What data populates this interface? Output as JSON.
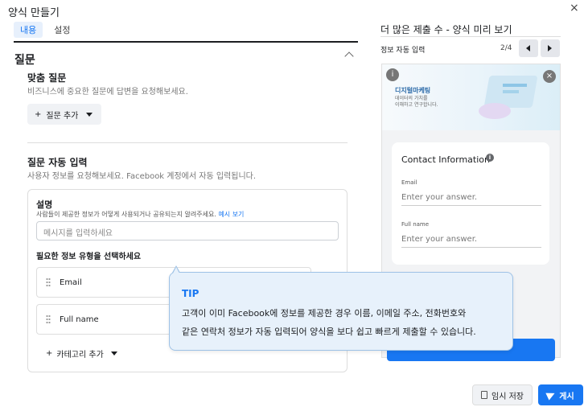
{
  "dialog": {
    "title": "양식 만들기",
    "close": "×"
  },
  "tabs": [
    {
      "label": "내용"
    },
    {
      "label": "설정"
    }
  ],
  "section": {
    "title": "질문"
  },
  "custom_questions": {
    "title": "맞춤 질문",
    "desc": "비즈니스에 중요한 질문에 답변을 요청해보세요.",
    "add_button": "질문 추가"
  },
  "autofill": {
    "title": "질문 자동 입력",
    "desc": "사용자 정보를 요청해보세요. Facebook 계정에서 자동 입력됩니다."
  },
  "description_card": {
    "label": "설명",
    "help": "사람들이 제공한 정보가 어떻게 사용되거나 공유되는지 알려주세요.",
    "help_link": "예시 보기",
    "placeholder": "메시지를 입력하세요",
    "required_label": "필요한 정보 유형을 선택하세요",
    "fields": [
      {
        "label": "Email"
      },
      {
        "label": "Full name"
      }
    ],
    "add_category": "카테고리 추가"
  },
  "preview": {
    "title": "더 많은 제출 수 - 양식 미리 보기",
    "subtitle": "정보 자동 입력",
    "page": "2/4",
    "banner": {
      "badge": "i",
      "close": "×",
      "headline": "디지털마케팅",
      "line1": "데이터의 가치를",
      "line2": "이해하고 연구합니다."
    },
    "form": {
      "heading": "Contact Information",
      "info_icon": "i",
      "fields": [
        {
          "label": "Email",
          "placeholder": "Enter your answer."
        },
        {
          "label": "Full name",
          "placeholder": "Enter your answer."
        }
      ]
    }
  },
  "tip": {
    "title": "TIP",
    "line1": "고객이 이미 Facebook에 정보를 제공한 경우 이름, 이메일 주소, 전화번호와",
    "line2": "같은 연락처 정보가 자동 입력되어 양식을 보다 쉽고 빠르게 제출할 수 있습니다."
  },
  "footer": {
    "save": "임시 저장",
    "publish": "게시"
  },
  "colors": {
    "accent": "#1877f2",
    "tip_bg": "#e7f1fb"
  }
}
